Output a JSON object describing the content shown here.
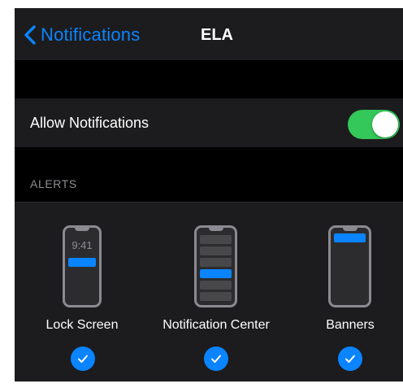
{
  "navbar": {
    "back_label": "Notifications",
    "title": "ELA"
  },
  "allow_notifications": {
    "label": "Allow Notifications",
    "enabled": true
  },
  "alerts": {
    "header": "ALERTS",
    "options": [
      {
        "label": "Lock Screen",
        "preview_time": "9:41",
        "selected": true
      },
      {
        "label": "Notification Center",
        "selected": true
      },
      {
        "label": "Banners",
        "selected": true
      }
    ]
  },
  "colors": {
    "accent": "#0a84ff",
    "toggle_on": "#34c759",
    "cell_bg": "#1c1c1e",
    "background": "#000000"
  },
  "icons": {
    "back": "chevron-left-icon",
    "check": "checkmark-circle-icon"
  }
}
